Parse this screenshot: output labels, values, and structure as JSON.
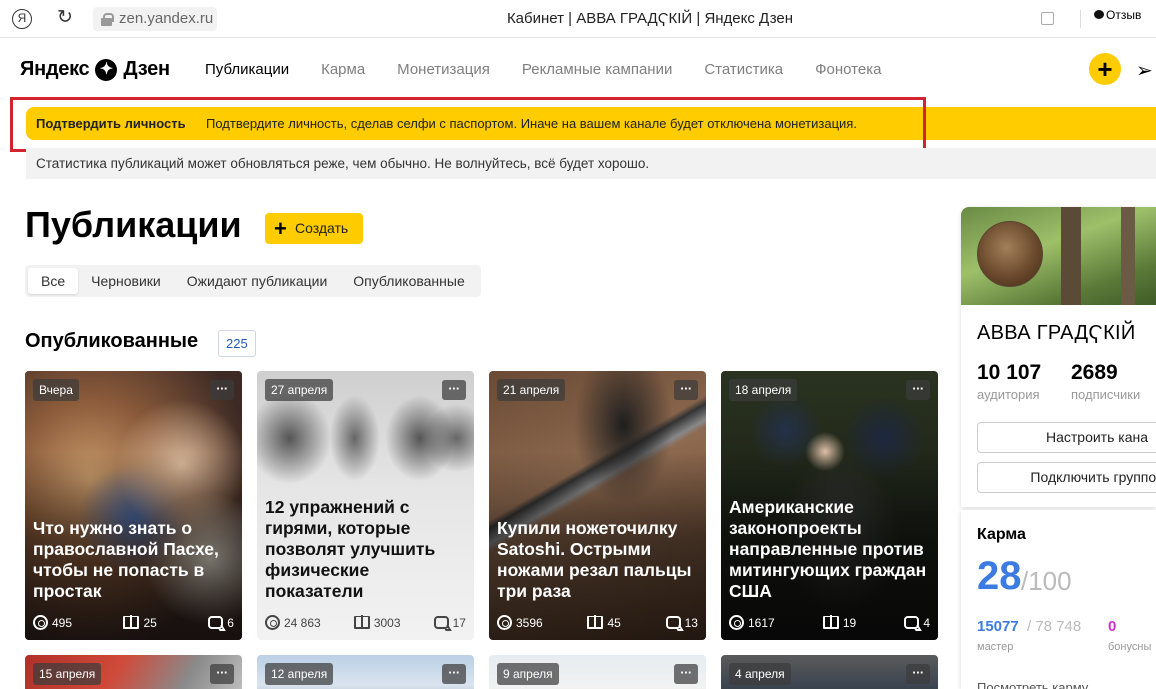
{
  "browser": {
    "ya_icon": "Я",
    "reload_icon": "↻",
    "url": "zen.yandex.ru",
    "title": "Кабинет | АВВА ГРАДҀКІЙ | Яндекс Дзен",
    "feedback": "Отзыв"
  },
  "header": {
    "logo_left": "Яндекс",
    "logo_right": "Дзен",
    "nav": [
      "Публикации",
      "Карма",
      "Монетизация",
      "Рекламные кампании",
      "Статистика",
      "Фонотека"
    ],
    "plus_label": "+",
    "send_icon": "➢"
  },
  "verify_banner": {
    "title": "Подтвердить личность",
    "text": "Подтвердите личность, сделав селфи с паспортом. Иначе на вашем канале будет отключена монетизация."
  },
  "stat_banner": {
    "text": "Статистика публикаций может обновляться реже, чем обычно. Не волнуйтесь, всё будет хорошо."
  },
  "publications": {
    "title": "Публикации",
    "create_plus": "+",
    "create_label": "Создать",
    "filters": [
      "Все",
      "Черновики",
      "Ожидают публикации",
      "Опубликованные"
    ],
    "published_title": "Опубликованные",
    "published_count": "225"
  },
  "cards": [
    {
      "date": "Вчера",
      "menu": "···",
      "title": "Что нужно знать о православной Пасхе, чтобы не попасть в простак",
      "views": "495",
      "reads": "25",
      "comments": "6"
    },
    {
      "date": "27 апреля",
      "menu": "···",
      "title": "12 упражнений с гирями, которые позволят улучшить физические показатели",
      "views": "24 863",
      "reads": "3003",
      "comments": "17"
    },
    {
      "date": "21 апреля",
      "menu": "···",
      "title": "Купили ножеточилку Satoshi. Острыми ножами резал пальцы три раза",
      "views": "3596",
      "reads": "45",
      "comments": "13"
    },
    {
      "date": "18 апреля",
      "menu": "···",
      "title": "Американские законопроекты направленные против митингующих граждан США",
      "views": "1617",
      "reads": "19",
      "comments": "4"
    }
  ],
  "cards_row2": [
    {
      "date": "15 апреля",
      "menu": "···"
    },
    {
      "date": "12 апреля",
      "menu": "···"
    },
    {
      "date": "9 апреля",
      "menu": "···"
    },
    {
      "date": "4 апреля",
      "menu": "···"
    }
  ],
  "profile": {
    "name": "АВВА ГРАДҀКІЙ",
    "audience": "10 107",
    "audience_label": "аудитория",
    "subscribers": "2689",
    "subscribers_label": "подписчики",
    "configure_btn": "Настроить кана",
    "group_btn": "Подключить группов"
  },
  "karma": {
    "title": "Карма",
    "value": "28",
    "max": "/100",
    "points": "15077",
    "points_max": "/ 78 748",
    "bonus": "0",
    "level_label": "мастер",
    "bonus_label": "бонусны",
    "link": "Посмотреть карму"
  }
}
